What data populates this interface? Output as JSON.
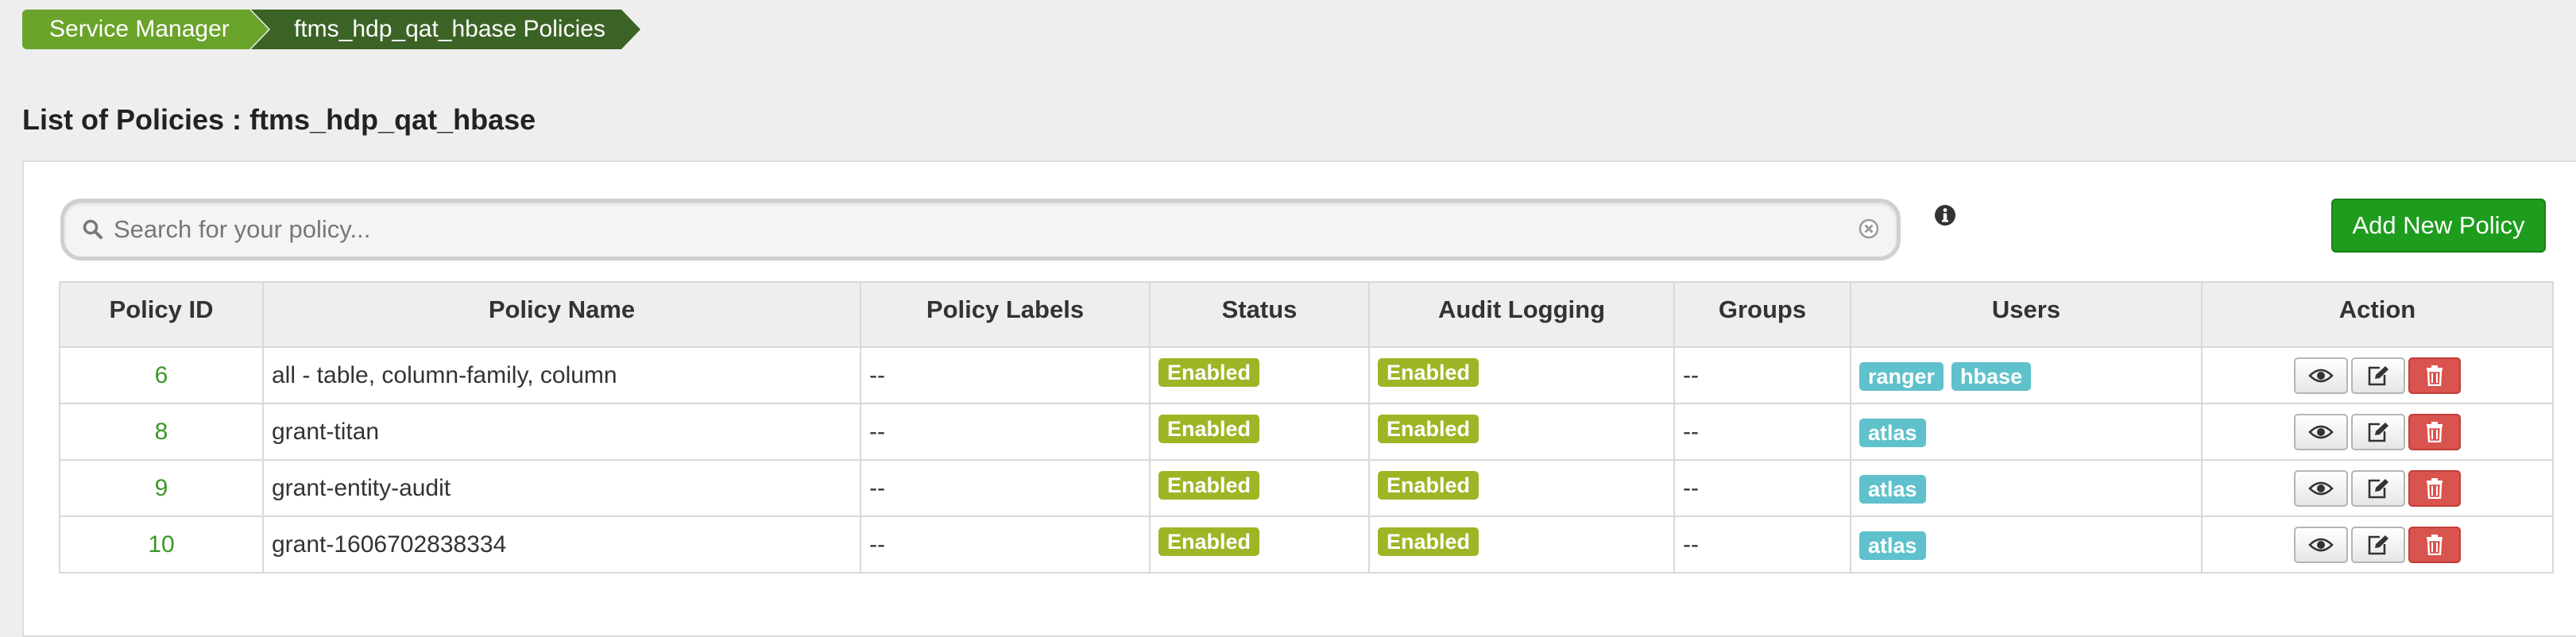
{
  "breadcrumb": {
    "items": [
      {
        "label": "Service Manager"
      },
      {
        "label": "ftms_hdp_qat_hbase Policies"
      }
    ]
  },
  "page_title": "List of Policies : ftms_hdp_qat_hbase",
  "search": {
    "placeholder": "Search for your policy...",
    "value": ""
  },
  "add_button_label": "Add New Policy",
  "icons": {
    "search": "search-icon",
    "clear": "clear-icon",
    "info": "info-icon",
    "view": "eye-icon",
    "edit": "edit-icon",
    "delete": "trash-icon"
  },
  "colors": {
    "breadcrumb_primary": "#6aa329",
    "breadcrumb_active": "#3c6326",
    "add_button": "#1d9c1d",
    "policy_id_link": "#3a9a25",
    "status_badge": "#9cb625",
    "user_badge": "#5fc1cc",
    "delete_button": "#d9534f"
  },
  "table": {
    "columns": [
      "Policy ID",
      "Policy Name",
      "Policy Labels",
      "Status",
      "Audit Logging",
      "Groups",
      "Users",
      "Action"
    ],
    "rows": [
      {
        "id": "6",
        "name": "all - table, column-family, column",
        "labels": "--",
        "status": "Enabled",
        "audit": "Enabled",
        "groups": "--",
        "users": [
          "ranger",
          "hbase"
        ]
      },
      {
        "id": "8",
        "name": "grant-titan",
        "labels": "--",
        "status": "Enabled",
        "audit": "Enabled",
        "groups": "--",
        "users": [
          "atlas"
        ]
      },
      {
        "id": "9",
        "name": "grant-entity-audit",
        "labels": "--",
        "status": "Enabled",
        "audit": "Enabled",
        "groups": "--",
        "users": [
          "atlas"
        ]
      },
      {
        "id": "10",
        "name": "grant-1606702838334",
        "labels": "--",
        "status": "Enabled",
        "audit": "Enabled",
        "groups": "--",
        "users": [
          "atlas"
        ]
      }
    ]
  }
}
